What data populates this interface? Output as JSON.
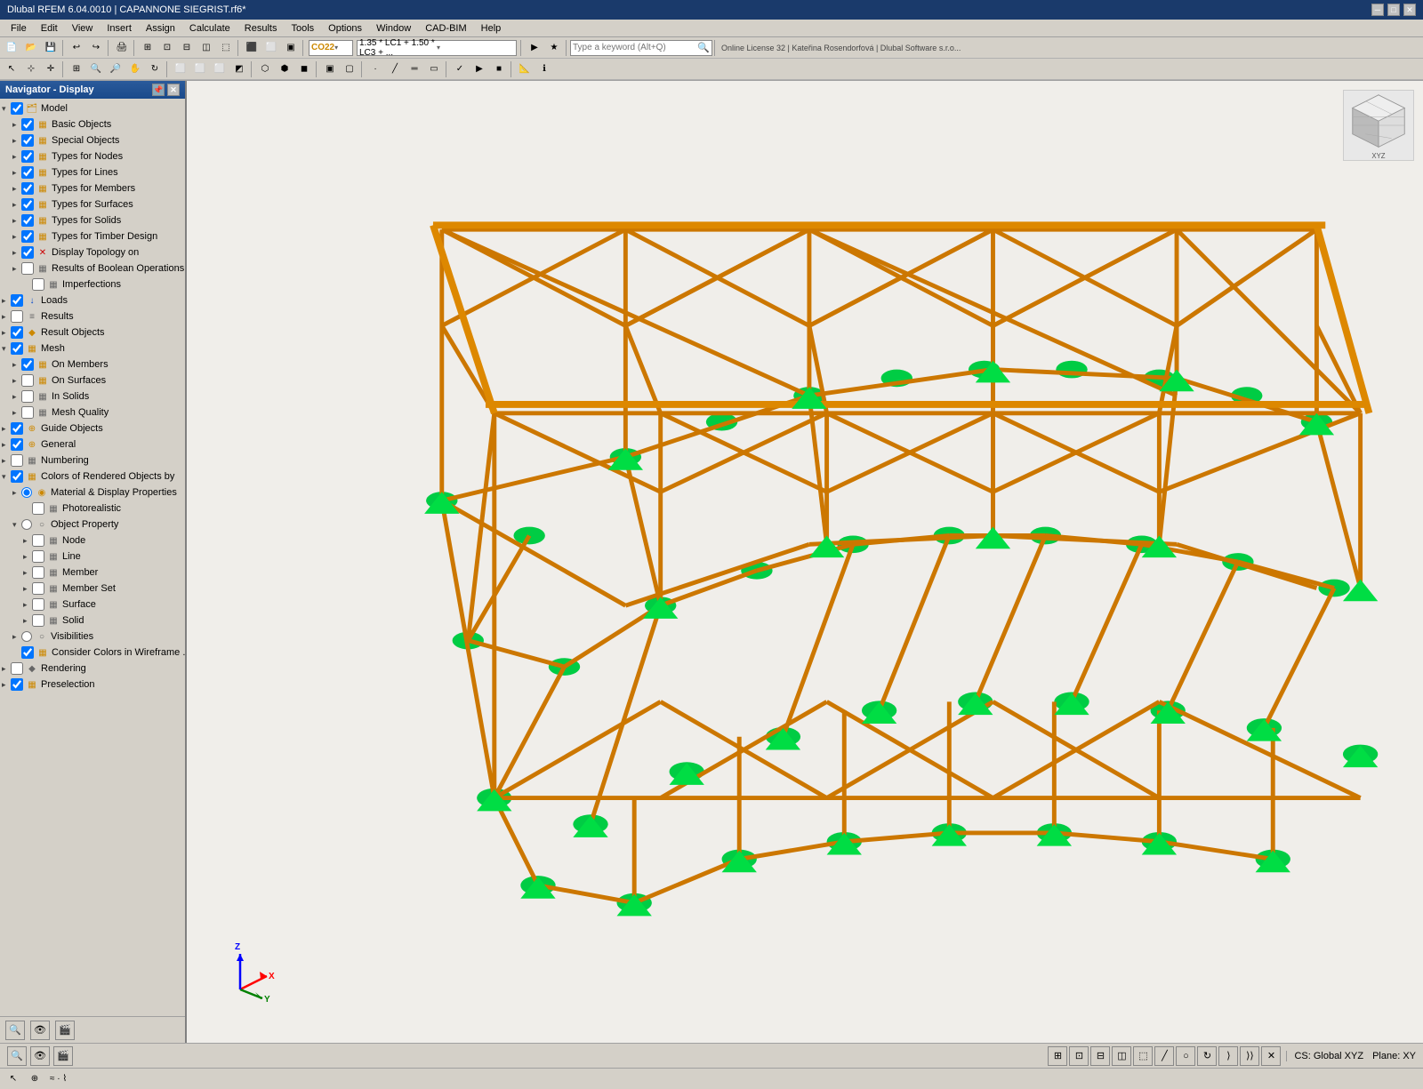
{
  "titlebar": {
    "title": "Dlubal RFEM 6.04.0010 | CAPANNONE SIEGRIST.rf6*",
    "controls": [
      "─",
      "□",
      "✕"
    ]
  },
  "menubar": {
    "items": [
      "File",
      "Edit",
      "View",
      "Insert",
      "Assign",
      "Calculate",
      "Results",
      "Tools",
      "Options",
      "Window",
      "CAD-BIM",
      "Help"
    ]
  },
  "toolbar": {
    "search_placeholder": "Type a keyword (Alt+Q)",
    "license_info": "Online License 32 | Kateřina Rosendorfová | Dlubal Software s.r.o...",
    "load_combo": "CO22",
    "load_factor": "1.35 * LC1 + 1.50 * LC3 + ..."
  },
  "navigator": {
    "title": "Navigator - Display",
    "tree": [
      {
        "id": "model",
        "level": 0,
        "label": "Model",
        "arrow": "▾",
        "checked": true,
        "icon": "🗂",
        "icon_color": "orange"
      },
      {
        "id": "basic-objects",
        "level": 1,
        "label": "Basic Objects",
        "arrow": "▸",
        "checked": true,
        "icon": "▦",
        "icon_color": "orange"
      },
      {
        "id": "special-objects",
        "level": 1,
        "label": "Special Objects",
        "arrow": "▸",
        "checked": true,
        "icon": "▦",
        "icon_color": "orange"
      },
      {
        "id": "types-nodes",
        "level": 1,
        "label": "Types for Nodes",
        "arrow": "▸",
        "checked": true,
        "icon": "▦",
        "icon_color": "orange"
      },
      {
        "id": "types-lines",
        "level": 1,
        "label": "Types for Lines",
        "arrow": "▸",
        "checked": true,
        "icon": "▦",
        "icon_color": "orange"
      },
      {
        "id": "types-members",
        "level": 1,
        "label": "Types for Members",
        "arrow": "▸",
        "checked": true,
        "icon": "▦",
        "icon_color": "orange"
      },
      {
        "id": "types-surfaces",
        "level": 1,
        "label": "Types for Surfaces",
        "arrow": "▸",
        "checked": true,
        "icon": "▦",
        "icon_color": "orange"
      },
      {
        "id": "types-solids",
        "level": 1,
        "label": "Types for Solids",
        "arrow": "▸",
        "checked": true,
        "icon": "▦",
        "icon_color": "orange"
      },
      {
        "id": "types-timber",
        "level": 1,
        "label": "Types for Timber Design",
        "arrow": "▸",
        "checked": true,
        "icon": "▦",
        "icon_color": "orange"
      },
      {
        "id": "display-topology",
        "level": 1,
        "label": "Display Topology on",
        "arrow": "▸",
        "checked": true,
        "icon": "✕",
        "icon_color": "red"
      },
      {
        "id": "results-boolean",
        "level": 1,
        "label": "Results of Boolean Operations",
        "arrow": "▸",
        "checked": false,
        "icon": "▦",
        "icon_color": "gray"
      },
      {
        "id": "imperfections",
        "level": 2,
        "label": "Imperfections",
        "arrow": "",
        "checked": false,
        "icon": "▦",
        "icon_color": "gray"
      },
      {
        "id": "loads",
        "level": 0,
        "label": "Loads",
        "arrow": "▸",
        "checked": true,
        "icon": "↓",
        "icon_color": "blue"
      },
      {
        "id": "results",
        "level": 0,
        "label": "Results",
        "arrow": "▸",
        "checked": false,
        "icon": "≡",
        "icon_color": "gray"
      },
      {
        "id": "result-objects",
        "level": 0,
        "label": "Result Objects",
        "arrow": "▸",
        "checked": true,
        "icon": "◆",
        "icon_color": "orange"
      },
      {
        "id": "mesh",
        "level": 0,
        "label": "Mesh",
        "arrow": "▾",
        "checked": true,
        "icon": "▦",
        "icon_color": "orange"
      },
      {
        "id": "on-members",
        "level": 1,
        "label": "On Members",
        "arrow": "▸",
        "checked": true,
        "icon": "▦",
        "icon_color": "orange"
      },
      {
        "id": "on-surfaces",
        "level": 1,
        "label": "On Surfaces",
        "arrow": "▸",
        "checked": false,
        "icon": "▦",
        "icon_color": "orange"
      },
      {
        "id": "in-solids",
        "level": 1,
        "label": "In Solids",
        "arrow": "▸",
        "checked": false,
        "icon": "▦",
        "icon_color": "gray"
      },
      {
        "id": "mesh-quality",
        "level": 1,
        "label": "Mesh Quality",
        "arrow": "▸",
        "checked": false,
        "icon": "▦",
        "icon_color": "gray"
      },
      {
        "id": "guide-objects",
        "level": 0,
        "label": "Guide Objects",
        "arrow": "▸",
        "checked": true,
        "icon": "⊕",
        "icon_color": "orange"
      },
      {
        "id": "general",
        "level": 0,
        "label": "General",
        "arrow": "▸",
        "checked": true,
        "icon": "⊕",
        "icon_color": "orange"
      },
      {
        "id": "numbering",
        "level": 0,
        "label": "Numbering",
        "arrow": "▸",
        "checked": false,
        "icon": "▦",
        "icon_color": "gray"
      },
      {
        "id": "colors-rendered",
        "level": 0,
        "label": "Colors of Rendered Objects by",
        "arrow": "▾",
        "checked": true,
        "icon": "▦",
        "icon_color": "orange"
      },
      {
        "id": "material-display",
        "level": 1,
        "label": "Material & Display Properties",
        "arrow": "▸",
        "radio": true,
        "radio_checked": true,
        "icon": "◉",
        "icon_color": "orange"
      },
      {
        "id": "photorealistic",
        "level": 2,
        "label": "Photorealistic",
        "arrow": "",
        "checked": false,
        "icon": "▦",
        "icon_color": "gray"
      },
      {
        "id": "object-property",
        "level": 1,
        "label": "Object Property",
        "arrow": "▾",
        "radio": true,
        "radio_checked": false,
        "icon": "○",
        "icon_color": "gray"
      },
      {
        "id": "node",
        "level": 2,
        "label": "Node",
        "arrow": "▸",
        "checked": false,
        "icon": "▦",
        "icon_color": "gray"
      },
      {
        "id": "line",
        "level": 2,
        "label": "Line",
        "arrow": "▸",
        "checked": false,
        "icon": "▦",
        "icon_color": "gray"
      },
      {
        "id": "member",
        "level": 2,
        "label": "Member",
        "arrow": "▸",
        "checked": false,
        "icon": "▦",
        "icon_color": "gray"
      },
      {
        "id": "member-set",
        "level": 2,
        "label": "Member Set",
        "arrow": "▸",
        "checked": false,
        "icon": "▦",
        "icon_color": "gray"
      },
      {
        "id": "surface",
        "level": 2,
        "label": "Surface",
        "arrow": "▸",
        "checked": false,
        "icon": "▦",
        "icon_color": "gray"
      },
      {
        "id": "solid",
        "level": 2,
        "label": "Solid",
        "arrow": "▸",
        "checked": false,
        "icon": "▦",
        "icon_color": "gray"
      },
      {
        "id": "visibilities",
        "level": 1,
        "label": "Visibilities",
        "arrow": "▸",
        "radio": true,
        "radio_checked": false,
        "icon": "○",
        "icon_color": "gray"
      },
      {
        "id": "consider-colors",
        "level": 1,
        "label": "Consider Colors in Wireframe ...",
        "arrow": "",
        "checked": true,
        "icon": "▦",
        "icon_color": "orange"
      },
      {
        "id": "rendering",
        "level": 0,
        "label": "Rendering",
        "arrow": "▸",
        "checked": false,
        "icon": "◆",
        "icon_color": "gray"
      },
      {
        "id": "preselection",
        "level": 0,
        "label": "Preselection",
        "arrow": "▸",
        "checked": true,
        "icon": "▦",
        "icon_color": "orange"
      }
    ]
  },
  "statusbar": {
    "cs_label": "CS: Global XYZ",
    "plane_label": "Plane: XY",
    "bottom_icons": [
      "🔍",
      "👁",
      "🎬"
    ]
  },
  "viewport": {
    "bg_color": "#f0eeea",
    "structure_color": "#cc7700",
    "base_color": "#00cc44"
  }
}
